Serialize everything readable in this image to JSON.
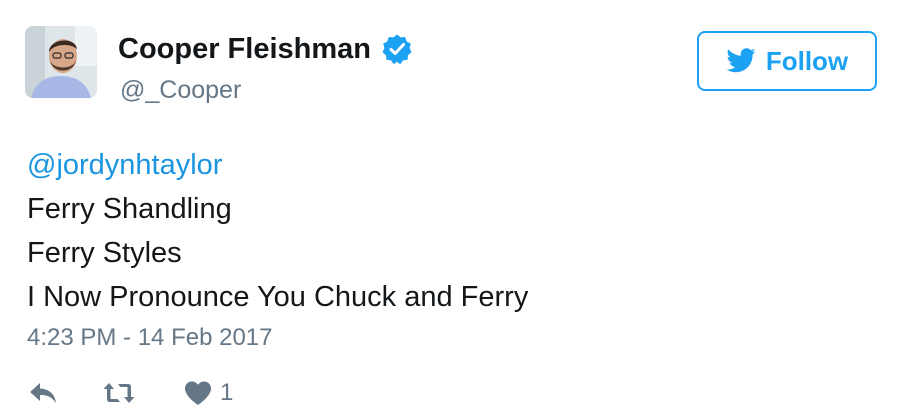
{
  "user": {
    "display_name": "Cooper Fleishman",
    "handle": "@_Cooper",
    "verified": true,
    "avatar_icon": "profile-photo"
  },
  "follow_button": {
    "label": "Follow",
    "icon": "twitter-bird-icon",
    "color": "#1da1f2"
  },
  "tweet": {
    "mention": "@jordynhtaylor",
    "lines": [
      "Ferry Shandling",
      "Ferry Styles",
      "I Now Pronounce You Chuck and Ferry"
    ],
    "timestamp": "4:23 PM - 14 Feb 2017"
  },
  "actions": {
    "reply_icon": "reply-icon",
    "retweet_icon": "retweet-icon",
    "like_icon": "heart-icon",
    "like_count": "1"
  },
  "colors": {
    "text": "#14171a",
    "secondary": "#657786",
    "link": "#1b95e0",
    "brand": "#1da1f2"
  }
}
